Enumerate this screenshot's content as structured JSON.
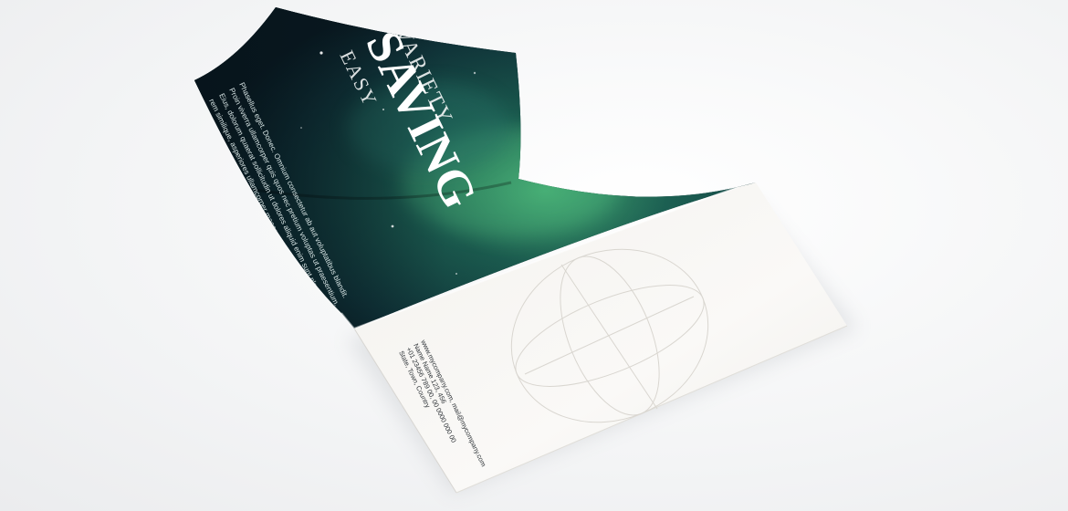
{
  "brochure": {
    "cover": {
      "headline_top": "VARIETY",
      "headline_main": "SAVING",
      "headline_bottom": "EASY",
      "body_lines": [
        "Phasellus eget. Donec. Omnium consectetur ab aut voluptatibus blandit.",
        "Proin viverra ullamcorper quis quos nec pretium voluptas ut praesentium.",
        "Eius, dolorum quaerat sollicitudin ut dolores aliquid enim sunt placeat,",
        "rem similique, asperiores ullamcorper maecenas soluta, provident."
      ]
    },
    "back": {
      "contact_lines": [
        "www.mycompany.com, mail@mycompany.com",
        "Name Name 123, 456",
        "+01 23456 789 00, 00 0000 000 00",
        "State, Town, Country"
      ]
    },
    "colors": {
      "cover_dark": "#0c1f26",
      "cover_teal": "#1f5e55",
      "cover_glow": "#4fc080",
      "paper": "#f7f5f2",
      "background": "#f2f3f4"
    }
  }
}
